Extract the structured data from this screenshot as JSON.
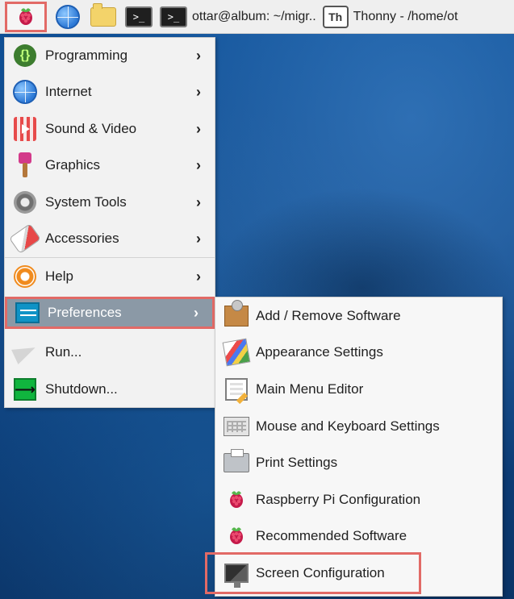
{
  "taskbar": {
    "terminal_window": "ottar@album: ~/migr..",
    "thonny_window": "Thonny  -  /home/ot"
  },
  "main_menu": {
    "items": [
      {
        "label": "Programming"
      },
      {
        "label": "Internet"
      },
      {
        "label": "Sound & Video"
      },
      {
        "label": "Graphics"
      },
      {
        "label": "System Tools"
      },
      {
        "label": "Accessories"
      },
      {
        "label": "Help"
      },
      {
        "label": "Preferences"
      },
      {
        "label": "Run..."
      },
      {
        "label": "Shutdown..."
      }
    ]
  },
  "submenu": {
    "items": [
      {
        "label": "Add / Remove Software"
      },
      {
        "label": "Appearance Settings"
      },
      {
        "label": "Main Menu Editor"
      },
      {
        "label": "Mouse and Keyboard Settings"
      },
      {
        "label": "Print Settings"
      },
      {
        "label": "Raspberry Pi Configuration"
      },
      {
        "label": "Recommended Software"
      },
      {
        "label": "Screen Configuration"
      }
    ]
  },
  "colors": {
    "highlight_outline": "#e26a66",
    "selected_row": "#8b99a6"
  }
}
